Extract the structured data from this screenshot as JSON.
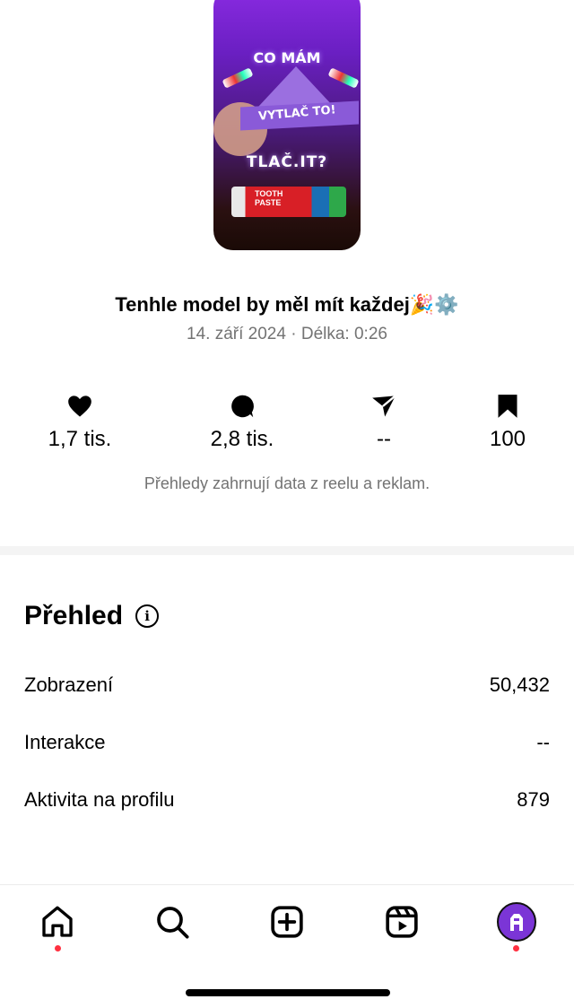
{
  "reel": {
    "thumbnail": {
      "text_top": "CO MÁM",
      "text_band": "VYTLAČ TO!",
      "text_mid": "TLAČ.IT?",
      "text_tube": "TOOTH PASTE"
    },
    "caption": "Tenhle model by měl mít každej🎉⚙️",
    "date": "14. září 2024",
    "length_label": "Délka: 0:26"
  },
  "stats": [
    {
      "icon": "heart-icon",
      "value": "1,7 tis."
    },
    {
      "icon": "comment-icon",
      "value": "2,8 tis."
    },
    {
      "icon": "share-icon",
      "value": "--"
    },
    {
      "icon": "save-icon",
      "value": "100"
    }
  ],
  "stats_note": "Přehledy zahrnují data z reelu a reklam.",
  "overview": {
    "title": "Přehled",
    "rows": [
      {
        "label": "Zobrazení",
        "value": "50,432"
      },
      {
        "label": "Interakce",
        "value": "--"
      },
      {
        "label": "Aktivita na profilu",
        "value": "879"
      }
    ]
  },
  "nav": {
    "items": [
      "home-icon",
      "search-icon",
      "create-icon",
      "reels-icon",
      "profile-avatar"
    ],
    "notification_color": "#ff3040"
  }
}
